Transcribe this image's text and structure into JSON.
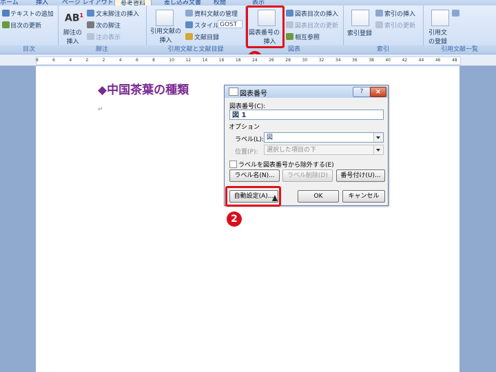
{
  "tabs": [
    "ホーム",
    "挿入",
    "ページ レイアウト",
    "参考資料",
    "差し込み文書",
    "校閲",
    "表示"
  ],
  "ribbon": {
    "toc": {
      "add_text": "テキストの追加",
      "update": "目次の更新",
      "label": "目次"
    },
    "footnote": {
      "insert_endnote": "文末脚注の挿入",
      "next_footnote": "次の脚注",
      "show_notes": "注の表示",
      "insert_footnote_l1": "脚注の",
      "insert_footnote_l2": "挿入",
      "label": "脚注"
    },
    "citations": {
      "insert_citation_l1": "引用文献の",
      "insert_citation_l2": "挿入",
      "manage_sources": "資料文献の管理",
      "style_label": "スタイル:",
      "style_value": "GOST",
      "bibliography": "文献目録",
      "label": "引用文献と文献目録"
    },
    "captions": {
      "insert_caption_l1": "図表番号の",
      "insert_caption_l2": "挿入",
      "insert_tof": "図表目次の挿入",
      "update_table": "図表目次の更新",
      "cross_ref": "相互参照",
      "label": "図表"
    },
    "index": {
      "mark_entry": "索引登録",
      "insert_index": "索引の挿入",
      "update_index": "索引の更新",
      "label": "索引"
    },
    "toa": {
      "mark_citation_l1": "引用文",
      "mark_citation_l2": "の登録",
      "label": "引用文献一覧"
    }
  },
  "ruler_ticks": [
    "8",
    "6",
    "4",
    "2",
    "2",
    "4",
    "6",
    "8",
    "10",
    "12",
    "14",
    "16",
    "18",
    "24",
    "26",
    "28",
    "30",
    "32",
    "34",
    "36",
    "38",
    "40",
    "42",
    "44",
    "46",
    "48"
  ],
  "document": {
    "heading": "◆中国茶葉の種類",
    "para_mark": "↵"
  },
  "dialog": {
    "title": "図表番号",
    "help": "?",
    "close": "×",
    "caption_label": "図表番号(C):",
    "caption_value": "図 1",
    "options_label": "オプション",
    "label_label": "ラベル(L):",
    "label_value": "図",
    "position_label": "位置(P):",
    "position_value": "選択した項目の下",
    "exclude_label": "ラベルを図表番号から除外する(E)",
    "new_label_btn": "ラベル名(N)...",
    "delete_label_btn": "ラベル削除(D)",
    "numbering_btn": "番号付け(U)...",
    "autocaption_btn": "自動設定(A)...",
    "ok_btn": "OK",
    "cancel_btn": "キャンセル"
  },
  "callouts": [
    "1",
    "2"
  ],
  "colors": {
    "highlight": "#e0101a",
    "heading": "#7b2a93"
  }
}
